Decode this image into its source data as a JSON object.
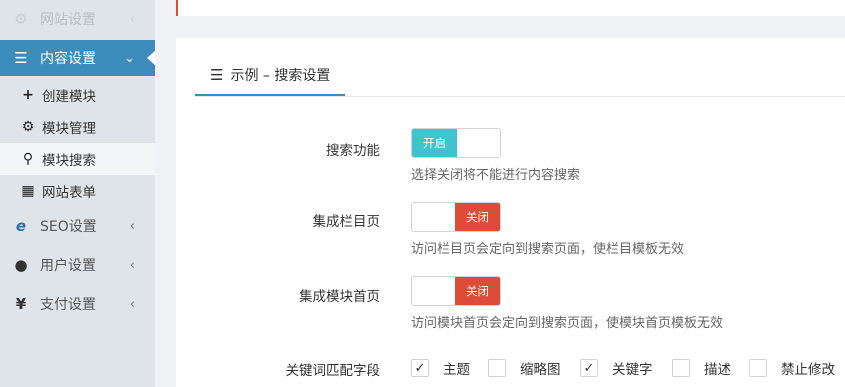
{
  "sidebar": {
    "items": [
      {
        "label": "网站设置",
        "icon": "gear-icon",
        "glyph": "⚙",
        "chevron": "‹"
      },
      {
        "label": "内容设置",
        "icon": "menu-icon",
        "glyph": "☰",
        "chevron": "⌄"
      },
      {
        "label": "SEO设置",
        "icon": "ie-icon",
        "glyph": "e",
        "chevron": "‹"
      },
      {
        "label": "用户设置",
        "icon": "user-icon",
        "glyph": "●",
        "chevron": "‹"
      },
      {
        "label": "支付设置",
        "icon": "yen-icon",
        "glyph": "¥",
        "chevron": "‹"
      }
    ],
    "subitems": [
      {
        "label": "创建模块",
        "icon": "plus-icon",
        "glyph": "+"
      },
      {
        "label": "模块管理",
        "icon": "gears-icon",
        "glyph": "⚙"
      },
      {
        "label": "模块搜索",
        "icon": "search-icon",
        "glyph": "⚲"
      },
      {
        "label": "网站表单",
        "icon": "table-icon",
        "glyph": "▦"
      }
    ]
  },
  "tab": {
    "label": "示例 – 搜索设置",
    "glyph": "☰"
  },
  "settings": [
    {
      "label": "搜索功能",
      "state": "on",
      "on_label": "开启",
      "help": "选择关闭将不能进行内容搜索"
    },
    {
      "label": "集成栏目页",
      "state": "off",
      "off_label": "关闭",
      "help": "访问栏目页会定向到搜索页面，使栏目模板无效"
    },
    {
      "label": "集成模块首页",
      "state": "off",
      "off_label": "关闭",
      "help": "访问模块首页会定向到搜索页面，使模块首页模板无效"
    }
  ],
  "fields": {
    "label": "关键词匹配字段",
    "options": [
      {
        "label": "主题",
        "checked": true
      },
      {
        "label": "缩略图",
        "checked": false
      },
      {
        "label": "关键字",
        "checked": true
      },
      {
        "label": "描述",
        "checked": false
      },
      {
        "label": "禁止修改",
        "checked": false
      }
    ],
    "check_glyph": "✓"
  },
  "colors": {
    "accent": "#3c8dbc",
    "on": "#3fc4cf",
    "off": "#dd4b39"
  }
}
